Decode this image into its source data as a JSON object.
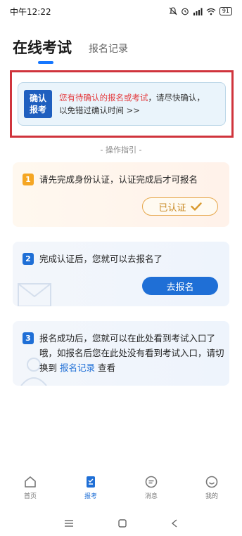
{
  "status_bar": {
    "time": "中午12:22",
    "battery": "91"
  },
  "tabs": {
    "active": "在线考试",
    "inactive": "报名记录"
  },
  "confirm_banner": {
    "badge_line1": "确认",
    "badge_line2": "报考",
    "highlight": "您有待确认的报名或考试",
    "rest_line1": "，请尽快确认，",
    "line2": "以免错过确认时间 >>"
  },
  "guide_label": "- 操作指引 -",
  "steps": [
    {
      "num": "1",
      "text": "请先完成身份认证，认证完成后才可报名",
      "button": "已认证"
    },
    {
      "num": "2",
      "text": "完成认证后，您就可以去报名了",
      "button": "去报名"
    },
    {
      "num": "3",
      "text_a": "报名成功后，您就可以在此处看到考试入口了哦，如报名后您在此处没有看到考试入口，请切换到",
      "link": "报名记录",
      "text_b": "查看"
    }
  ],
  "tabbar": [
    {
      "label": "首页",
      "icon": "home-icon"
    },
    {
      "label": "报考",
      "icon": "exam-icon"
    },
    {
      "label": "消息",
      "icon": "message-icon"
    },
    {
      "label": "我的",
      "icon": "profile-icon"
    }
  ],
  "colors": {
    "accent": "#1f6fd6",
    "highlight_red": "#e4393c",
    "frame_red": "#d0343c",
    "orange": "#f5a623"
  }
}
